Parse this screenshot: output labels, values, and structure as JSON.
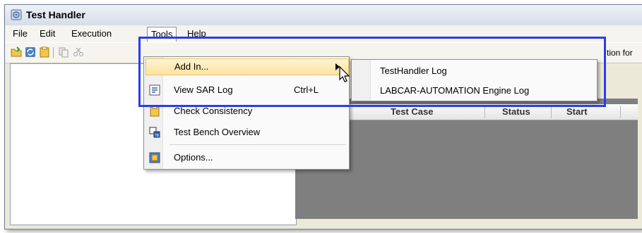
{
  "window": {
    "title": "Test Handler"
  },
  "menubar": {
    "items": [
      "File",
      "Edit",
      "Execution",
      "Tools",
      "Help"
    ]
  },
  "toolbar": {
    "truncated_text": "tion for"
  },
  "tools_menu": {
    "items": [
      {
        "label": "Add In...",
        "shortcut": "",
        "icon": "add-in-icon"
      },
      {
        "label": "View SAR Log",
        "shortcut": "Ctrl+L",
        "icon": "sar-log-icon"
      },
      {
        "label": "Check Consistency",
        "shortcut": "",
        "icon": "check-consistency-icon"
      },
      {
        "label": "Test Bench Overview",
        "shortcut": "",
        "icon": "test-bench-icon"
      },
      {
        "label": "Options...",
        "shortcut": "",
        "icon": "options-icon"
      }
    ]
  },
  "add_in_submenu": {
    "items": [
      "TestHandler Log",
      "LABCAR-AUTOMATION Engine Log"
    ]
  },
  "table": {
    "columns": [
      "Test Case",
      "Status",
      "Start"
    ]
  },
  "colors": {
    "highlight_box": "#2a3cf0",
    "menu_hover": "#fde3a0"
  }
}
